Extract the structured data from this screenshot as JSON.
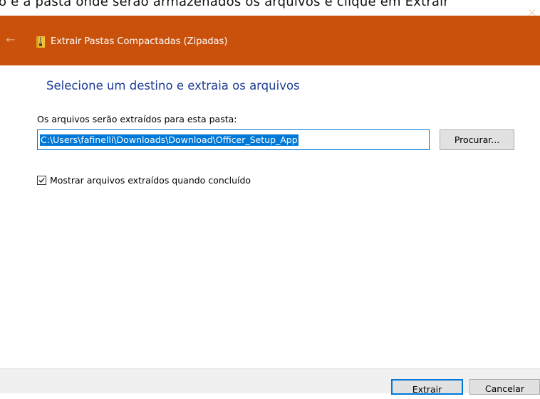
{
  "background_window": {
    "partial_text": "o e a pasta onde serão armazenados os arquivos e clique em Extrair"
  },
  "dialog": {
    "title": "Extrair Pastas Compactadas (Zipadas)",
    "title_bar_color": "#c9510c",
    "close_glyph": "×",
    "back_glyph": "←",
    "heading": "Selecione um destino e extraia os arquivos",
    "path_label": "Os arquivos serão extraídos para esta pasta:",
    "path_value": "C:\\Users\\fafinelli\\Downloads\\Download\\Officer_Setup_App",
    "browse_label": "Procurar...",
    "show_files_label": "Mostrar arquivos extraídos quando concluído",
    "show_files_checked": true,
    "extract_label": "Extrair",
    "cancel_label": "Cancelar",
    "accent_color": "#0078d7",
    "heading_color": "#1b3c96"
  },
  "icons": {
    "title_icon": "zip-folder-icon",
    "back": "back-arrow-icon",
    "close": "close-icon",
    "check": "checkmark-icon"
  }
}
